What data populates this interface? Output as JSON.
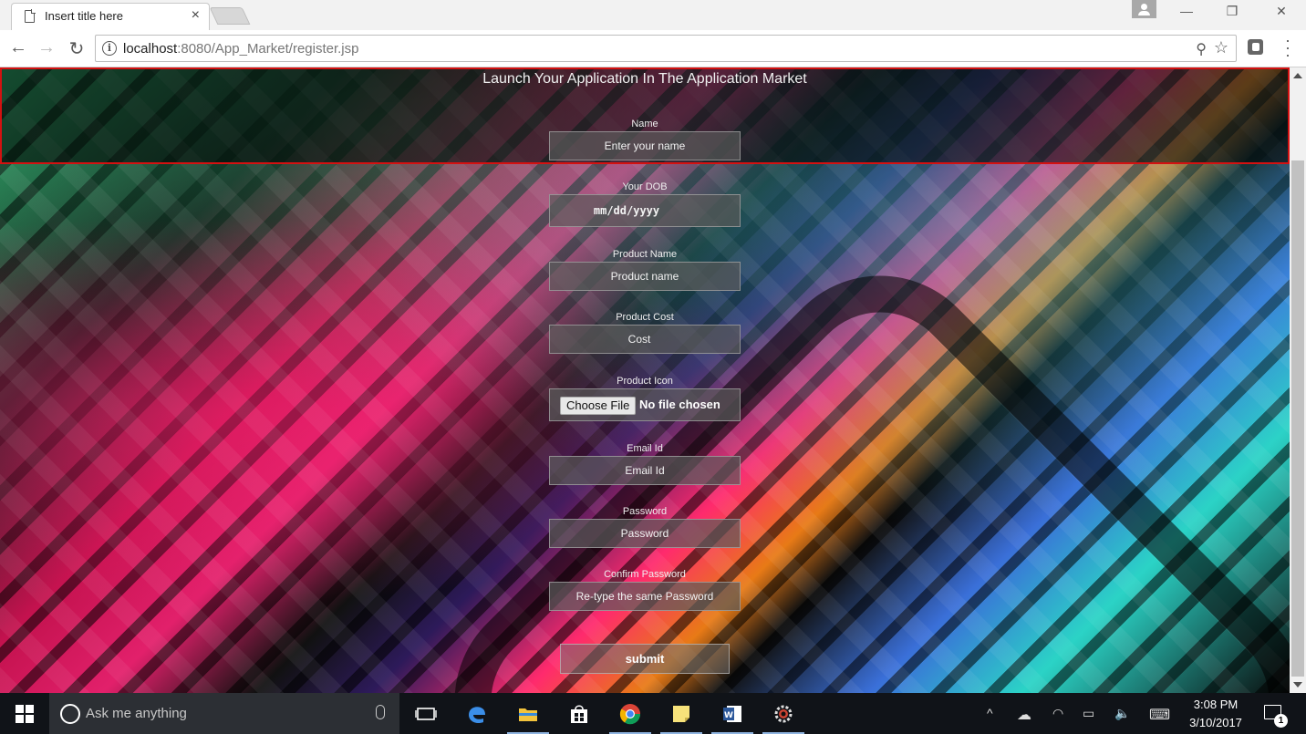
{
  "browser": {
    "tab_title": "Insert title here",
    "tab_close": "×",
    "url_host": "localhost",
    "url_rest": ":8080/App_Market/register.jsp",
    "window_controls": {
      "minimize": "—",
      "restore": "❐",
      "close": "✕"
    },
    "icons": [
      "page-icon",
      "profile-icon",
      "back-icon",
      "forward-icon",
      "reload-icon",
      "info-icon",
      "zoom-icon",
      "star-icon",
      "extension-icon",
      "menu-icon"
    ]
  },
  "page": {
    "heading": "Launch Your Application In The Application Market",
    "fields": {
      "name": {
        "label": "Name",
        "placeholder": "Enter your name"
      },
      "dob": {
        "label": "Your DOB",
        "placeholder": "mm/dd/yyyy"
      },
      "product_name": {
        "label": "Product Name",
        "placeholder": "Product name"
      },
      "product_cost": {
        "label": "Product Cost",
        "placeholder": "Cost"
      },
      "product_icon": {
        "label": "Product Icon",
        "button": "Choose File",
        "status": "No file chosen"
      },
      "email": {
        "label": "Email Id",
        "placeholder": "Email Id"
      },
      "password": {
        "label": "Password",
        "placeholder": "Password"
      },
      "confirm_password": {
        "label": "Confirm Password",
        "placeholder": "Re-type the same Password"
      }
    },
    "submit_label": "submit",
    "colors": {
      "highlight_border": "#d41111",
      "field_bg": "#5a5a5a"
    }
  },
  "taskbar": {
    "search_placeholder": "Ask me anything",
    "apps": [
      "task-view-icon",
      "edge-icon",
      "file-explorer-icon",
      "store-icon",
      "chrome-icon",
      "sticky-notes-icon",
      "word-icon",
      "settings-gear-icon"
    ],
    "tray": {
      "chevron": "^",
      "time": "3:08 PM",
      "date": "3/10/2017",
      "notifications": "1"
    }
  }
}
